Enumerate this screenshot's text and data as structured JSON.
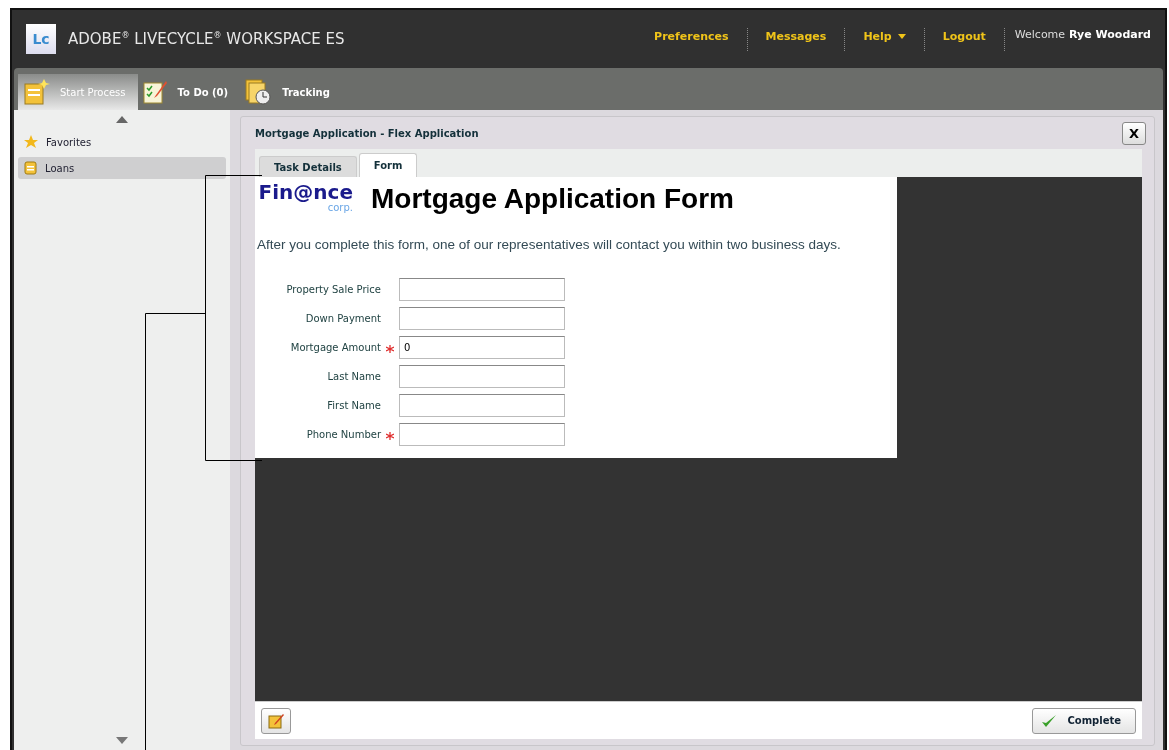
{
  "header": {
    "logo": "Lc",
    "title": "ADOBE$^{®}$ LIVECYCLE$^{®}$ WORKSPACE ES",
    "links": [
      {
        "label": "Preferences",
        "dropdown": false
      },
      {
        "label": "Messages",
        "dropdown": false
      },
      {
        "label": "Help",
        "dropdown": true
      },
      {
        "label": "Logout",
        "dropdown": false
      }
    ],
    "welcome": "Welcome",
    "user": "Rye Woodard"
  },
  "nav": {
    "tabs": [
      {
        "label": "Start Process",
        "selected": true
      },
      {
        "label": "To Do (0)",
        "selected": false
      },
      {
        "label": "Tracking",
        "selected": false
      }
    ]
  },
  "sidebar": {
    "items": [
      {
        "label": "Favorites",
        "selected": false
      },
      {
        "label": "Loans",
        "selected": true
      }
    ]
  },
  "panel": {
    "title": "Mortgage Application - Flex Application",
    "close": "X",
    "tabs": [
      {
        "label": "Task Details",
        "selected": false
      },
      {
        "label": "Form",
        "selected": true
      }
    ],
    "form": {
      "logo": "Fin@nce",
      "logo_sub": "corp.",
      "heading": "Mortgage Application Form",
      "intro": "After you complete this form, one of our representatives will contact you within two business days.",
      "fields": [
        {
          "label": "Property Sale Price",
          "required": false
        },
        {
          "label": "Down Payment",
          "required": false
        },
        {
          "label": "Mortgage Amount",
          "value": "0",
          "required": true
        },
        {
          "label": "Last Name",
          "required": false
        },
        {
          "label": "First Name",
          "required": false
        },
        {
          "label": "Phone Number",
          "required": true
        }
      ]
    },
    "complete": "Complete"
  }
}
